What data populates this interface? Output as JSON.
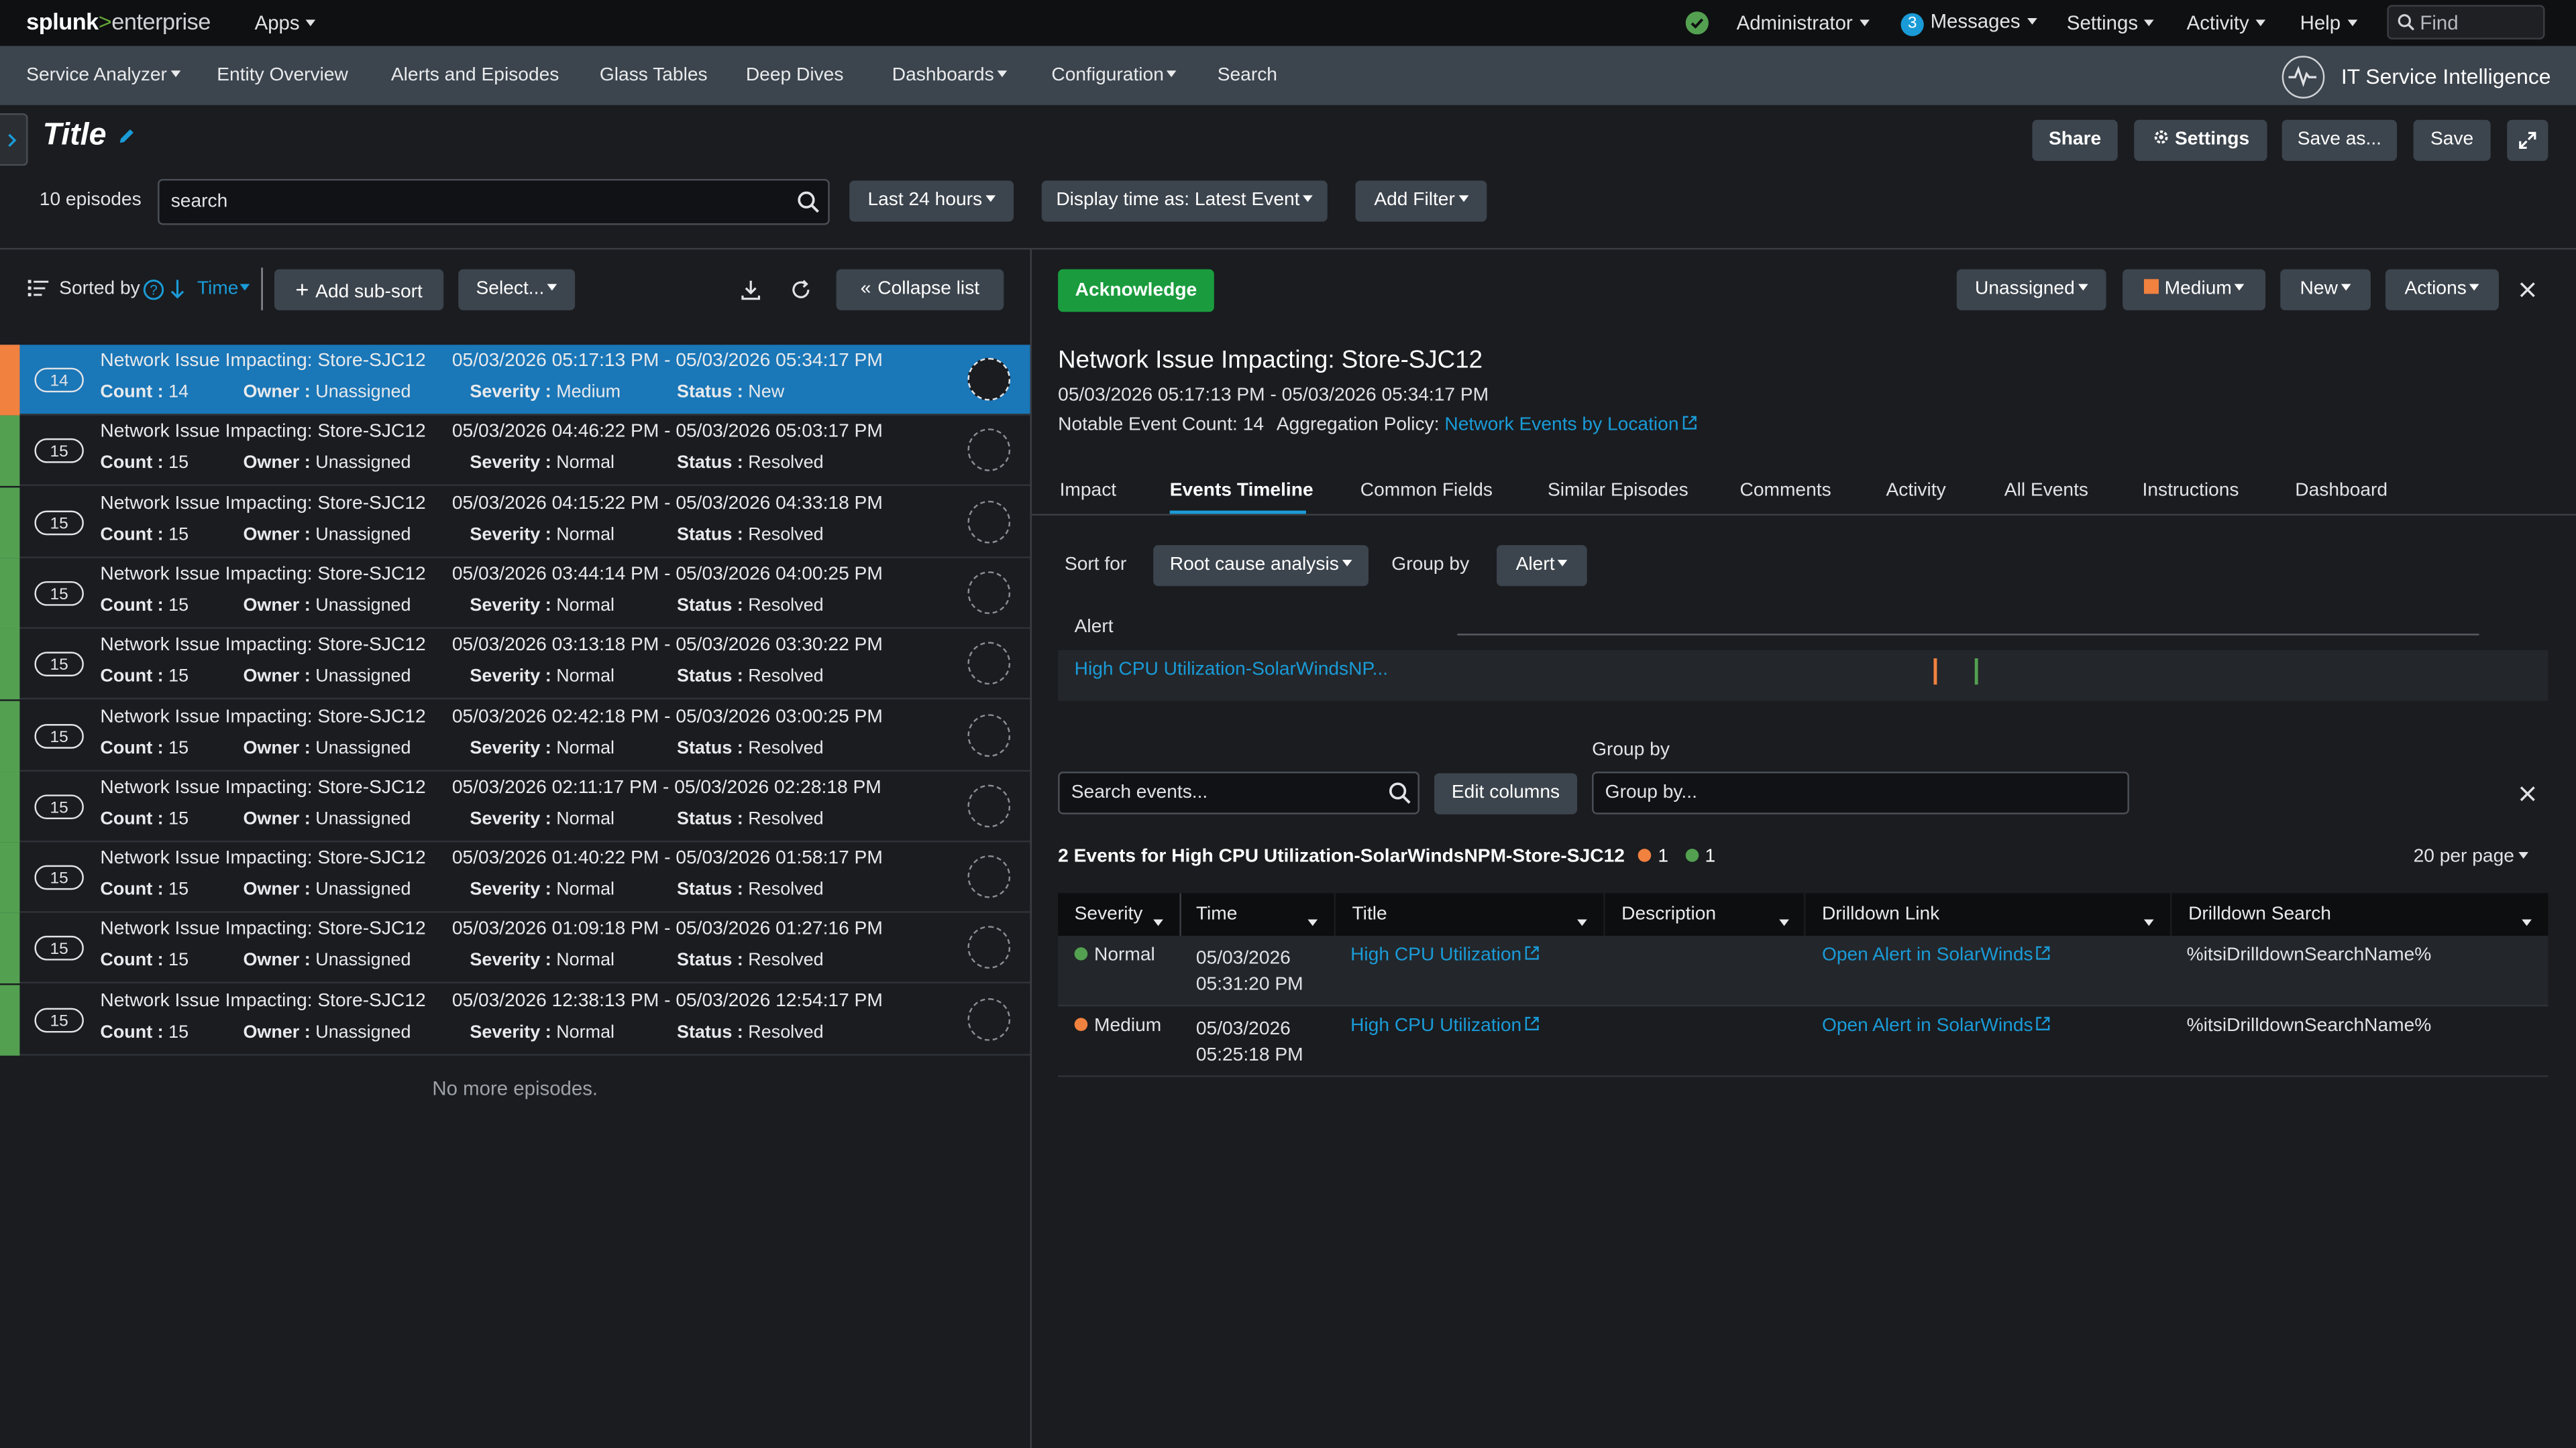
{
  "brand": {
    "splunk": "splunk",
    "gt": ">",
    "enterprise": "enterprise"
  },
  "topnav": {
    "apps": "Apps",
    "administrator": "Administrator",
    "messages_count": "3",
    "messages": "Messages",
    "settings": "Settings",
    "activity": "Activity",
    "help": "Help",
    "find_placeholder": "Find"
  },
  "appnav": {
    "items": [
      "Service Analyzer",
      "Entity Overview",
      "Alerts and Episodes",
      "Glass Tables",
      "Deep Dives",
      "Dashboards",
      "Configuration",
      "Search"
    ],
    "app_title": "IT Service Intelligence"
  },
  "header": {
    "title": "Title",
    "share": "Share",
    "settings": "Settings",
    "save_as": "Save as...",
    "save": "Save"
  },
  "filters": {
    "episode_count": "10 episodes",
    "search_value": "search",
    "time_range": "Last 24 hours",
    "display_time": "Display time as: Latest Event",
    "add_filter": "Add Filter"
  },
  "list_toolbar": {
    "sorted_by": "Sorted by",
    "sort_field": "Time",
    "add_subsort": "Add sub-sort",
    "select": "Select...",
    "collapse": "Collapse list"
  },
  "episodes": [
    {
      "badge": "14",
      "title": "Network Issue Impacting: Store-SJC12",
      "range": "05/03/2026 05:17:13 PM - 05/03/2026 05:34:17 PM",
      "count": "14",
      "owner": "Unassigned",
      "severity": "Medium",
      "status": "New"
    },
    {
      "badge": "15",
      "title": "Network Issue Impacting: Store-SJC12",
      "range": "05/03/2026 04:46:22 PM - 05/03/2026 05:03:17 PM",
      "count": "15",
      "owner": "Unassigned",
      "severity": "Normal",
      "status": "Resolved"
    },
    {
      "badge": "15",
      "title": "Network Issue Impacting: Store-SJC12",
      "range": "05/03/2026 04:15:22 PM - 05/03/2026 04:33:18 PM",
      "count": "15",
      "owner": "Unassigned",
      "severity": "Normal",
      "status": "Resolved"
    },
    {
      "badge": "15",
      "title": "Network Issue Impacting: Store-SJC12",
      "range": "05/03/2026 03:44:14 PM - 05/03/2026 04:00:25 PM",
      "count": "15",
      "owner": "Unassigned",
      "severity": "Normal",
      "status": "Resolved"
    },
    {
      "badge": "15",
      "title": "Network Issue Impacting: Store-SJC12",
      "range": "05/03/2026 03:13:18 PM - 05/03/2026 03:30:22 PM",
      "count": "15",
      "owner": "Unassigned",
      "severity": "Normal",
      "status": "Resolved"
    },
    {
      "badge": "15",
      "title": "Network Issue Impacting: Store-SJC12",
      "range": "05/03/2026 02:42:18 PM - 05/03/2026 03:00:25 PM",
      "count": "15",
      "owner": "Unassigned",
      "severity": "Normal",
      "status": "Resolved"
    },
    {
      "badge": "15",
      "title": "Network Issue Impacting: Store-SJC12",
      "range": "05/03/2026 02:11:17 PM - 05/03/2026 02:28:18 PM",
      "count": "15",
      "owner": "Unassigned",
      "severity": "Normal",
      "status": "Resolved"
    },
    {
      "badge": "15",
      "title": "Network Issue Impacting: Store-SJC12",
      "range": "05/03/2026 01:40:22 PM - 05/03/2026 01:58:17 PM",
      "count": "15",
      "owner": "Unassigned",
      "severity": "Normal",
      "status": "Resolved"
    },
    {
      "badge": "15",
      "title": "Network Issue Impacting: Store-SJC12",
      "range": "05/03/2026 01:09:18 PM - 05/03/2026 01:27:16 PM",
      "count": "15",
      "owner": "Unassigned",
      "severity": "Normal",
      "status": "Resolved"
    },
    {
      "badge": "15",
      "title": "Network Issue Impacting: Store-SJC12",
      "range": "05/03/2026 12:38:13 PM - 05/03/2026 12:54:17 PM",
      "count": "15",
      "owner": "Unassigned",
      "severity": "Normal",
      "status": "Resolved"
    }
  ],
  "episode_labels": {
    "count": "Count :",
    "owner": "Owner :",
    "severity": "Severity :",
    "status": "Status :"
  },
  "no_more": "No more episodes.",
  "detail": {
    "acknowledge": "Acknowledge",
    "owner": "Unassigned",
    "severity": "Medium",
    "status": "New",
    "actions": "Actions",
    "title": "Network Issue Impacting: Store-SJC12",
    "range": "05/03/2026 05:17:13 PM - 05/03/2026 05:34:17 PM",
    "notable_count": "Notable Event Count: 14",
    "policy_label": "Aggregation Policy:",
    "policy_link": "Network Events by Location",
    "tabs": [
      "Impact",
      "Events Timeline",
      "Common Fields",
      "Similar Episodes",
      "Comments",
      "Activity",
      "All Events",
      "Instructions",
      "Dashboard"
    ],
    "sort_for": "Sort for",
    "sort_value": "Root cause analysis",
    "group_by": "Group by",
    "group_value": "Alert",
    "timeline_header": "Alert",
    "timeline_row": "High CPU Utilization-SolarWindsNP...",
    "search_placeholder": "Search events...",
    "edit_columns": "Edit columns",
    "group_by_label": "Group by",
    "group_by_placeholder": "Group by...",
    "events_title": "2 Events for High CPU Utilization-SolarWindsNPM-Store-SJC12",
    "count_orange": "1",
    "count_green": "1",
    "per_page": "20 per page"
  },
  "events_table": {
    "headers": [
      "Severity",
      "Time",
      "Title",
      "Description",
      "Drilldown Link",
      "Drilldown Search"
    ],
    "rows": [
      {
        "severity": "Normal",
        "date": "05/03/2026",
        "time": "05:31:20 PM",
        "title": "High CPU Utilization",
        "description": "",
        "link": "Open Alert in SolarWinds",
        "search": "%itsiDrilldownSearchName%"
      },
      {
        "severity": "Medium",
        "date": "05/03/2026",
        "time": "05:25:18 PM",
        "title": "High CPU Utilization",
        "description": "",
        "link": "Open Alert in SolarWinds",
        "search": "%itsiDrilldownSearchName%"
      }
    ]
  },
  "colors": {
    "normal": "#53a051",
    "medium": "#f1813f",
    "selected": "#1a77b8",
    "link": "#1a9bd7",
    "acknowledge": "#1a9c3e"
  }
}
